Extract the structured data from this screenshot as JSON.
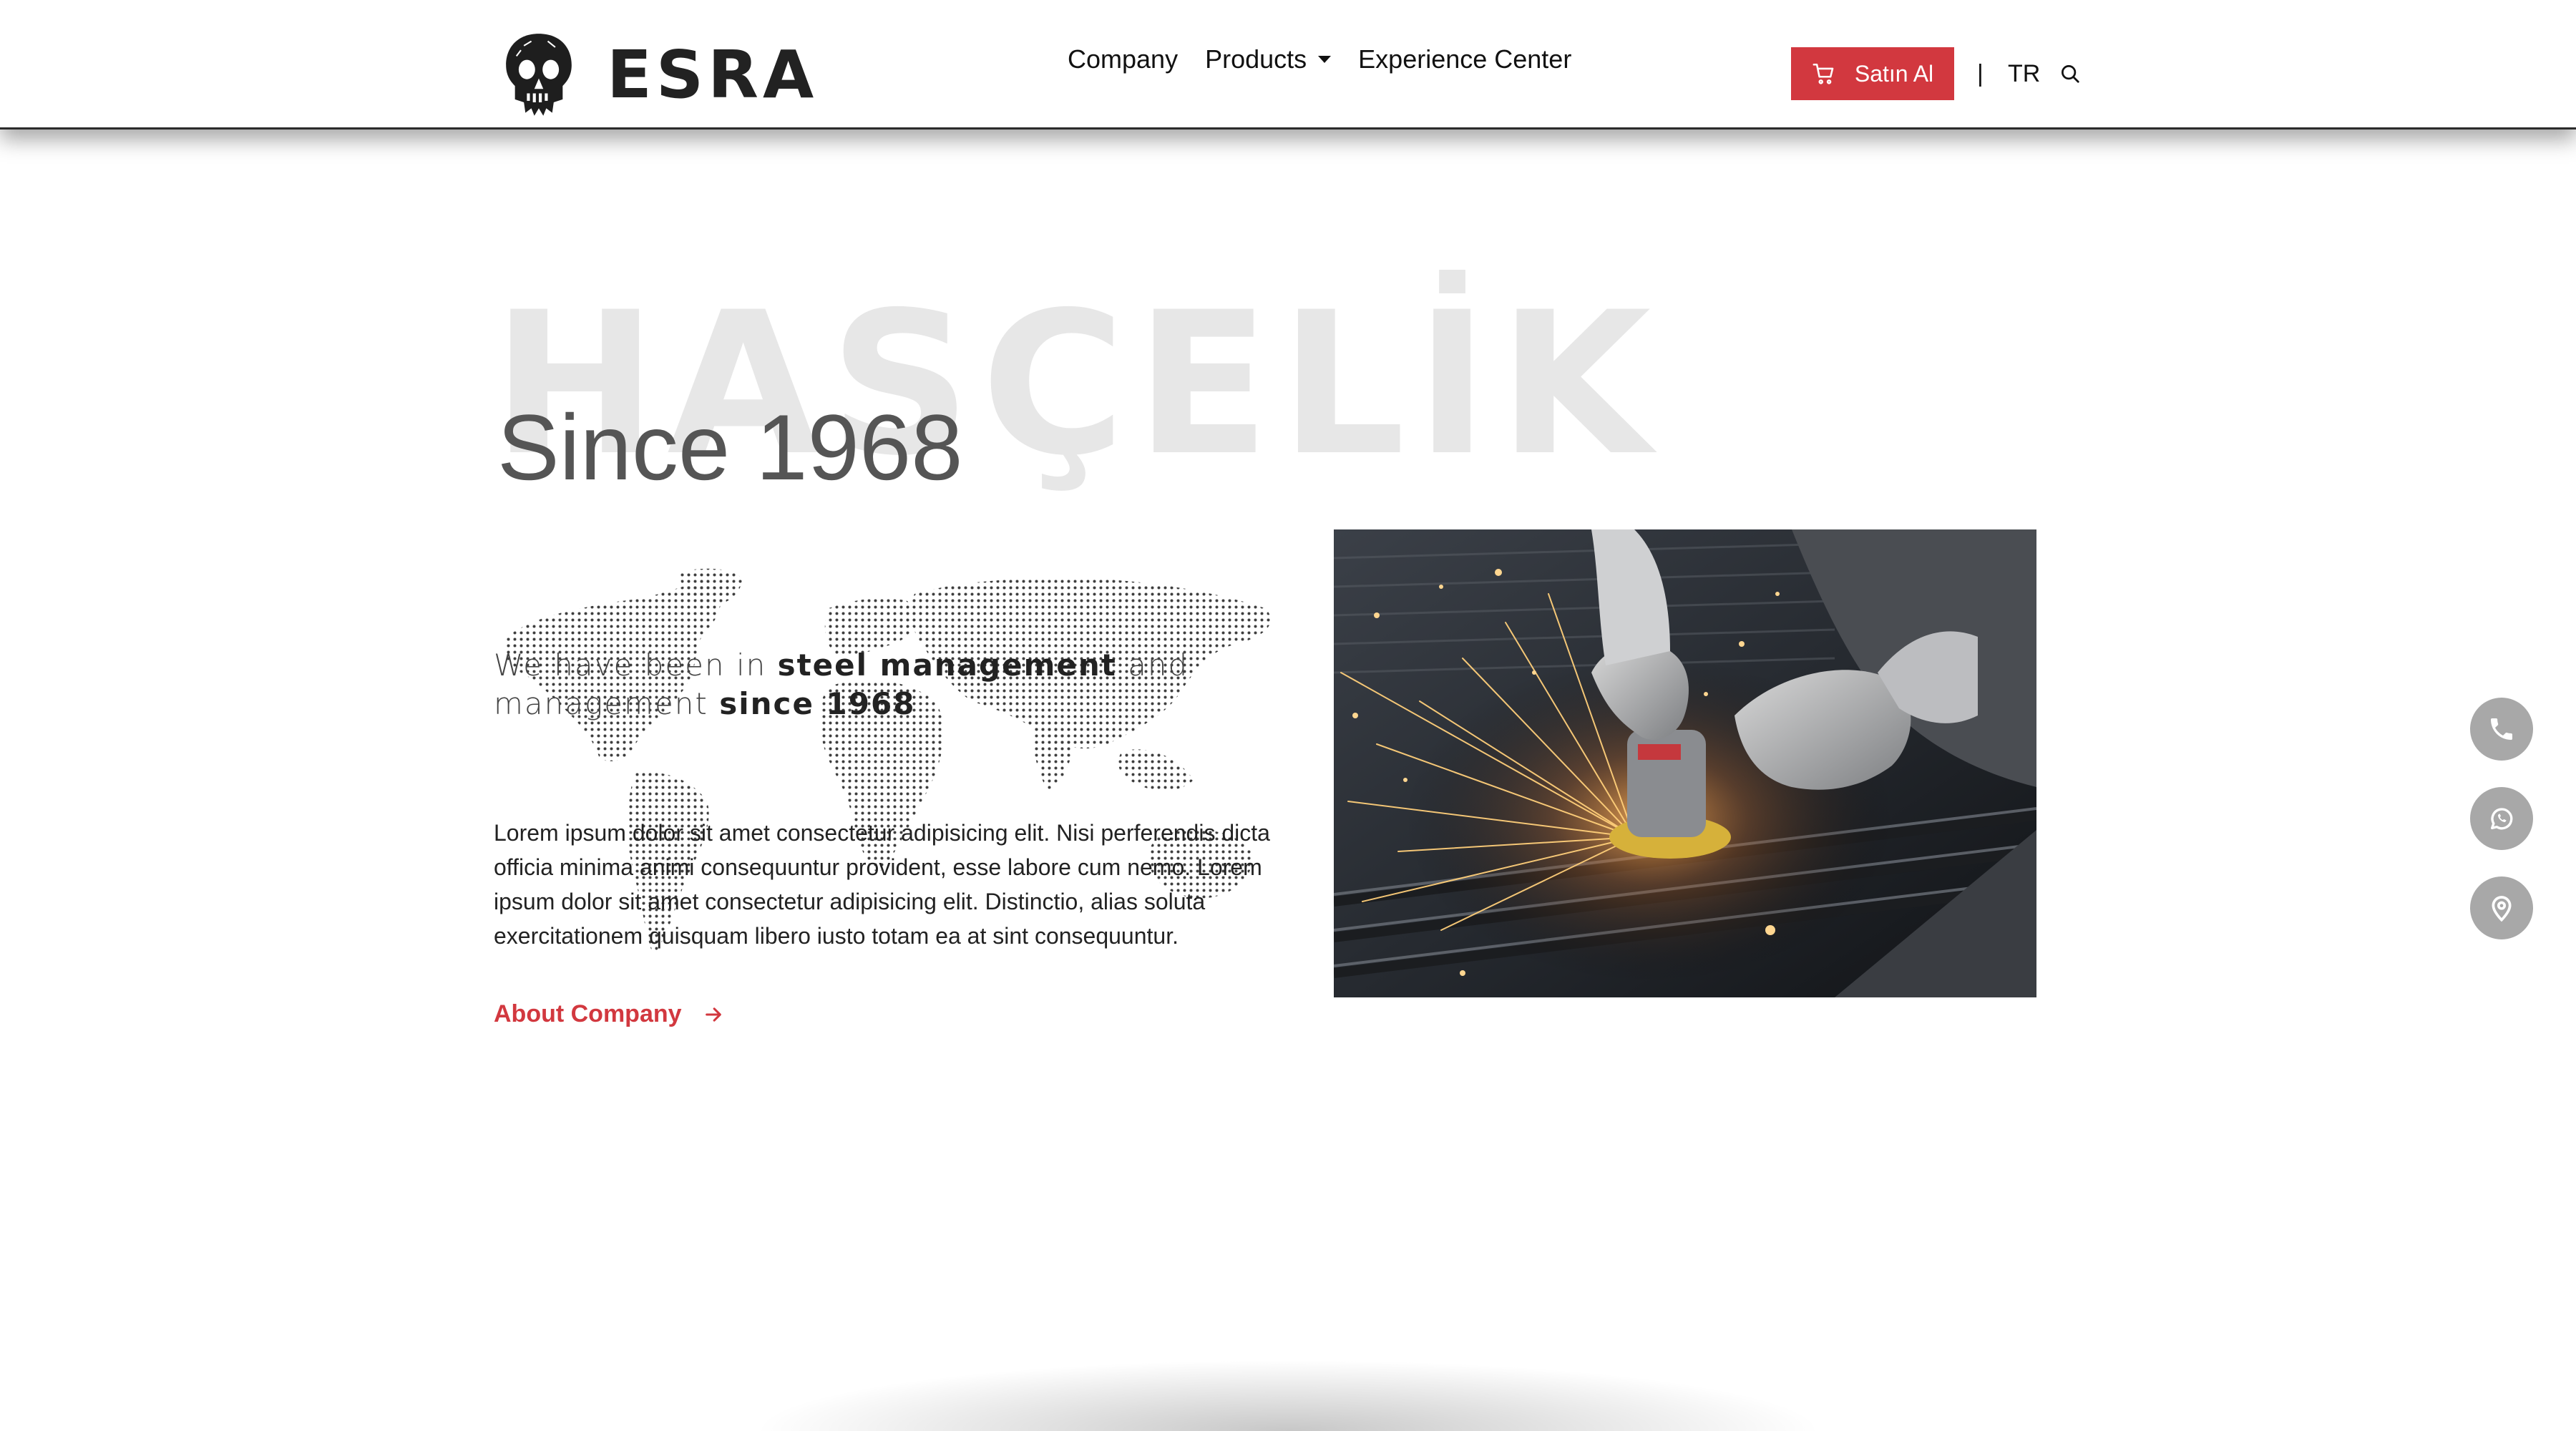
{
  "header": {
    "brand": "ESRA",
    "nav": [
      {
        "label": "Company"
      },
      {
        "label": "Products"
      },
      {
        "label": "Experience Center"
      }
    ],
    "buy_label": "Satın Al",
    "separator": "|",
    "language": "TR"
  },
  "hero": {
    "background_word": "HASÇELİK",
    "title": "Since 1968",
    "tagline_part1": "We have been in ",
    "tagline_bold1": "steel management",
    "tagline_part2": " and management ",
    "tagline_bold2": "since 1968",
    "paragraph": "Lorem ipsum dolor sit amet consectetur adipisicing elit. Nisi perferendis dicta officia minima animi consequuntur provident, esse labore cum nemo. Lorem ipsum dolor sit amet consectetur adipisicing elit. Distinctio, alias soluta exercitationem quisquam libero iusto totam ea at sint consequuntur.",
    "link_label": "About Company"
  },
  "floating_actions": [
    {
      "icon": "phone-icon"
    },
    {
      "icon": "whatsapp-icon"
    },
    {
      "icon": "location-icon"
    }
  ],
  "colors": {
    "accent": "#d2383f",
    "float_button": "#a8a8a8",
    "background_word": "#e7e7e7"
  }
}
